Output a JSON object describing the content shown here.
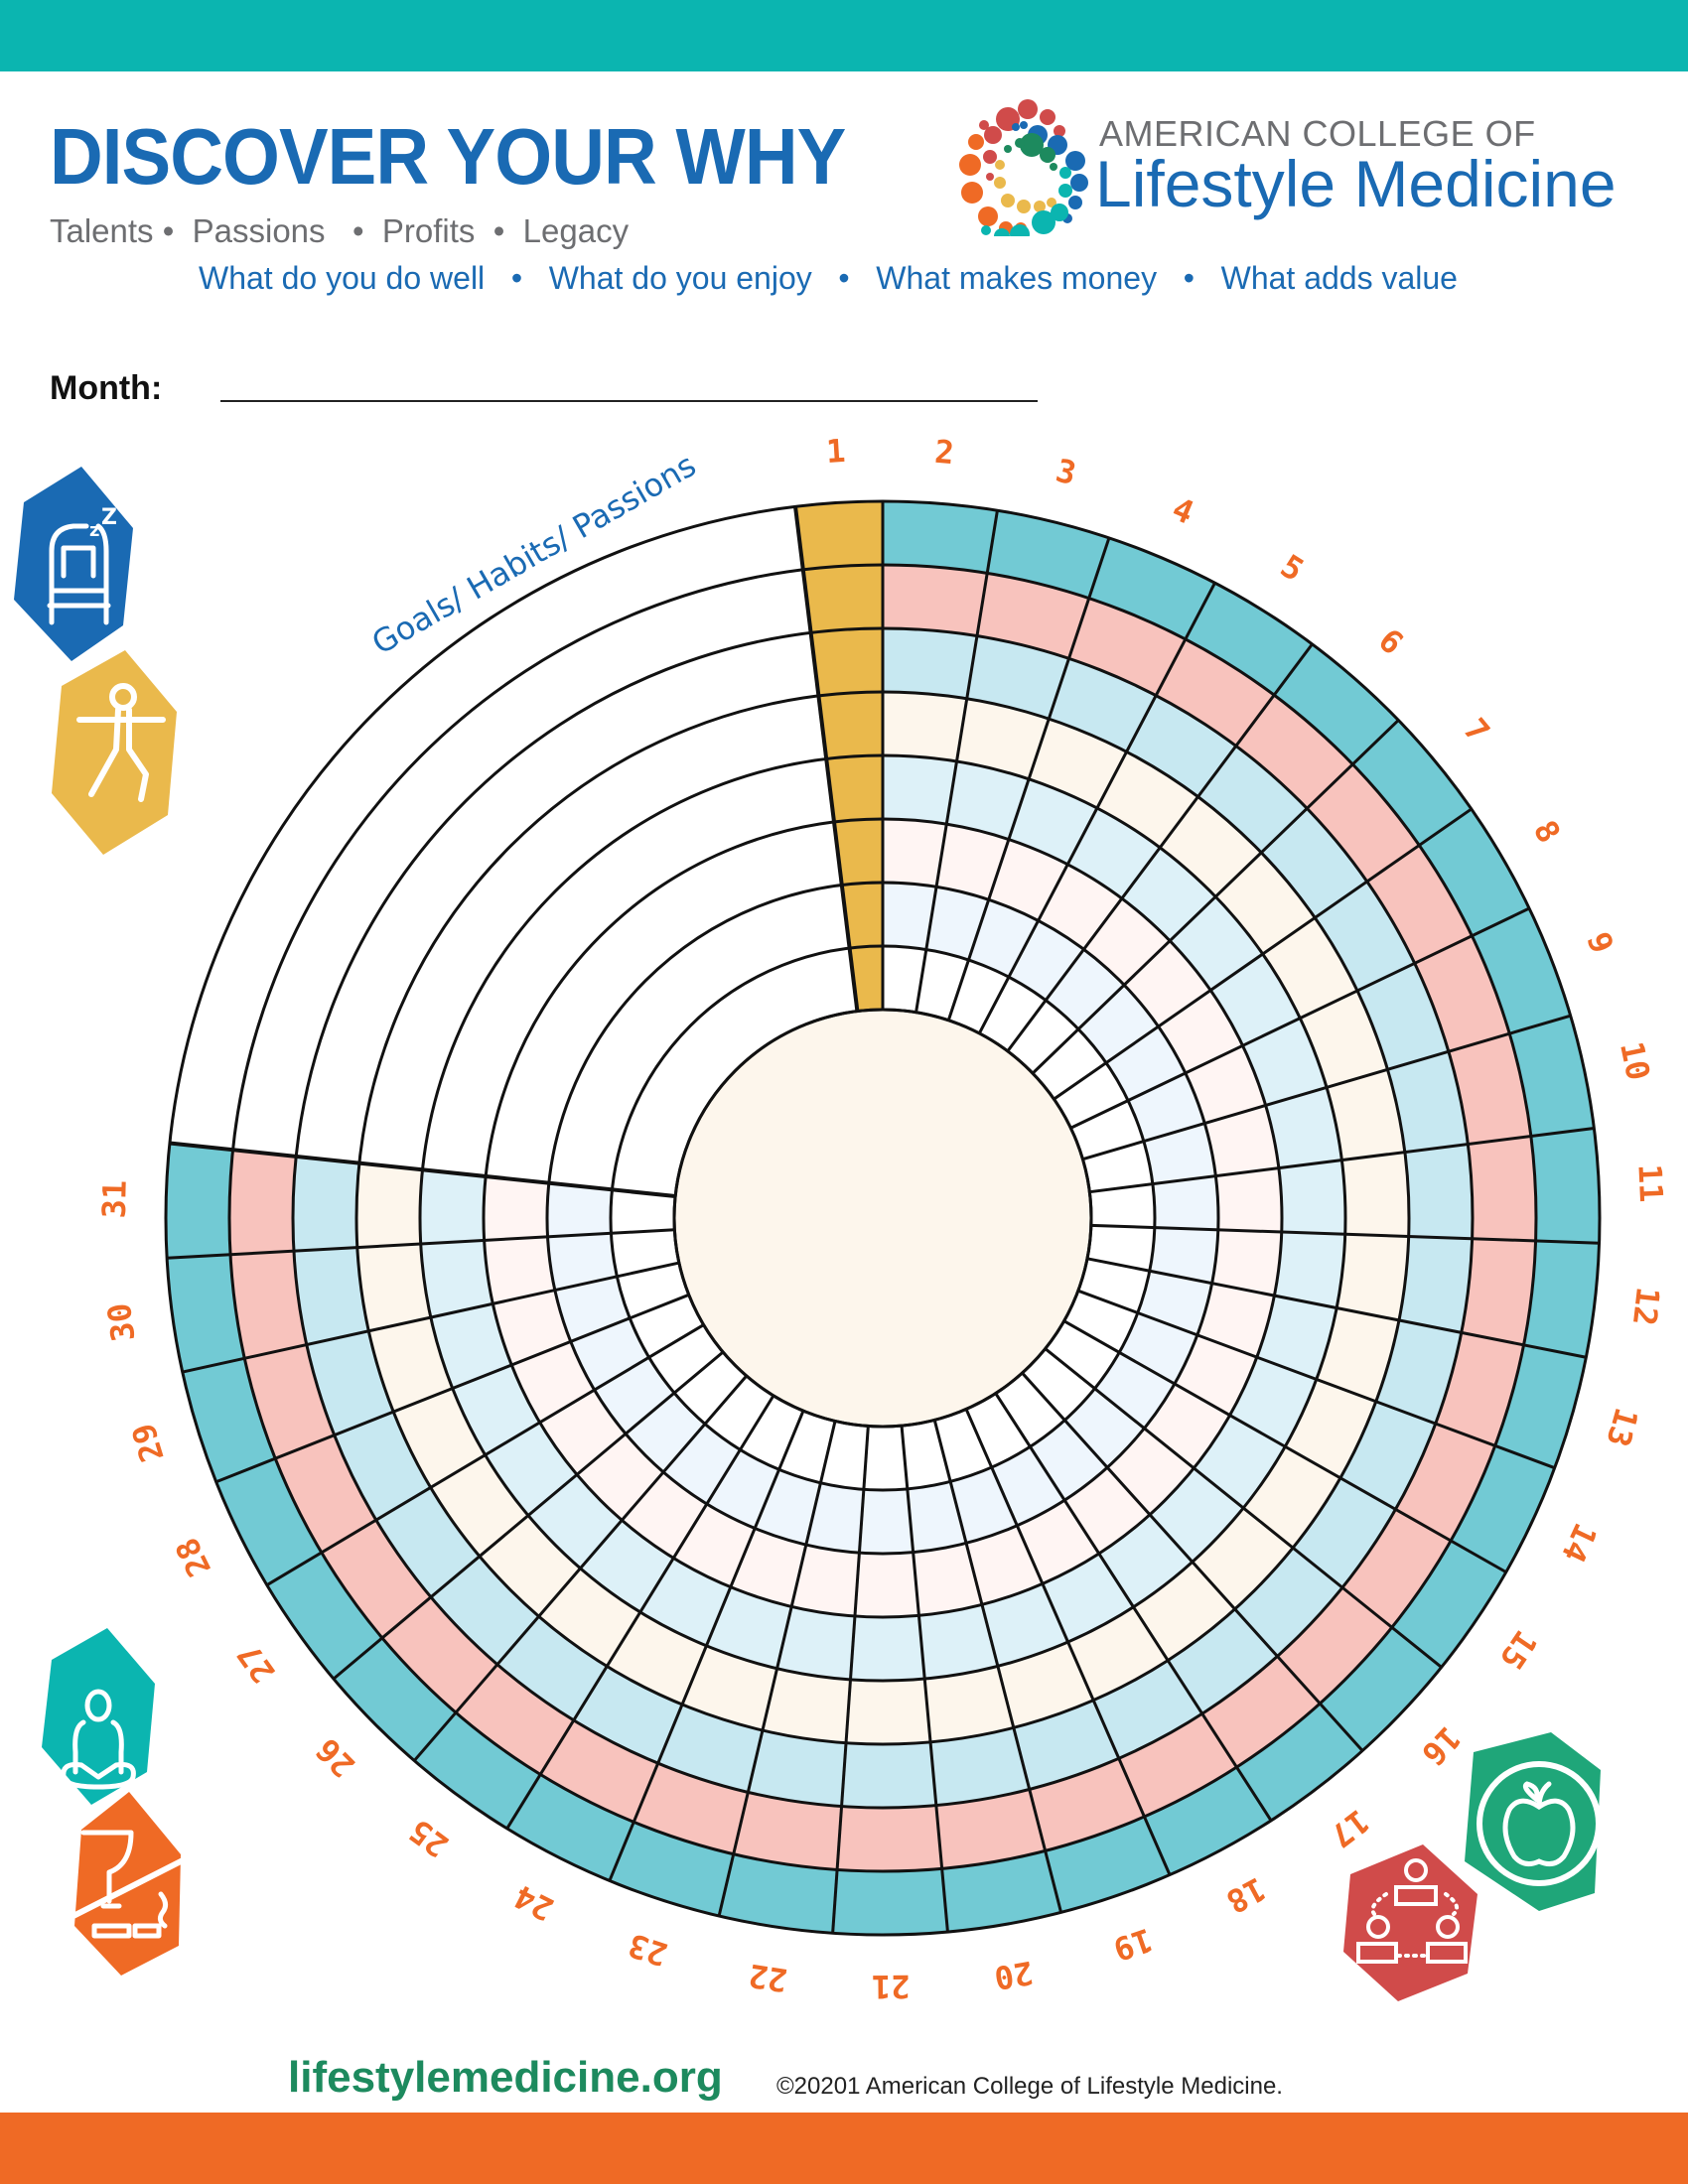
{
  "header": {
    "title": "DISCOVER YOUR WHY",
    "subtitle": "Talents •  Passions   •  Profits  •  Legacy",
    "questions": "What do you do well   •   What do you enjoy   •   What makes money   •   What adds value"
  },
  "organization": {
    "line1": "AMERICAN COLLEGE OF",
    "line2": "Lifestyle Medicine",
    "logo_icon": "dot-ring-logo"
  },
  "form": {
    "month_label": "Month:",
    "month_value": ""
  },
  "wheel": {
    "goals_label": "Goals/ Habits/ Passions",
    "days": [
      "1",
      "2",
      "3",
      "4",
      "5",
      "6",
      "7",
      "8",
      "9",
      "10",
      "11",
      "12",
      "13",
      "14",
      "15",
      "16",
      "17",
      "18",
      "19",
      "20",
      "21",
      "22",
      "23",
      "24",
      "25",
      "26",
      "27",
      "28",
      "29",
      "30",
      "31"
    ],
    "ring_count": 8,
    "ring_colors_outer_to_inner": [
      "#72cad4",
      "#f8c3bd",
      "#c7e8f1",
      "#fdf6ec",
      "#ddf1f8",
      "#fff5f3",
      "#eef6fd",
      "#ffffff"
    ],
    "highlight_day": "1",
    "highlight_color": "#eab94c",
    "center_color": "#fdf6ec",
    "day_label_color": "#ef6a25"
  },
  "icons": [
    {
      "name": "sleep-icon",
      "color": "#1a6ab3"
    },
    {
      "name": "exercise-icon",
      "color": "#eab94c"
    },
    {
      "name": "stress-management-icon",
      "color": "#0bb5b0"
    },
    {
      "name": "avoid-risky-substances-icon",
      "color": "#ef6a25"
    },
    {
      "name": "nutrition-icon",
      "color": "#1fa679"
    },
    {
      "name": "social-connection-icon",
      "color": "#d04b4a"
    }
  ],
  "footer": {
    "url": "lifestylemedicine.org",
    "copyright": "©20201 American College of Lifestyle Medicine."
  },
  "colors": {
    "top_bar": "#0bb5b0",
    "bottom_bar": "#ef6a25",
    "brand_blue": "#1a6ab3"
  }
}
